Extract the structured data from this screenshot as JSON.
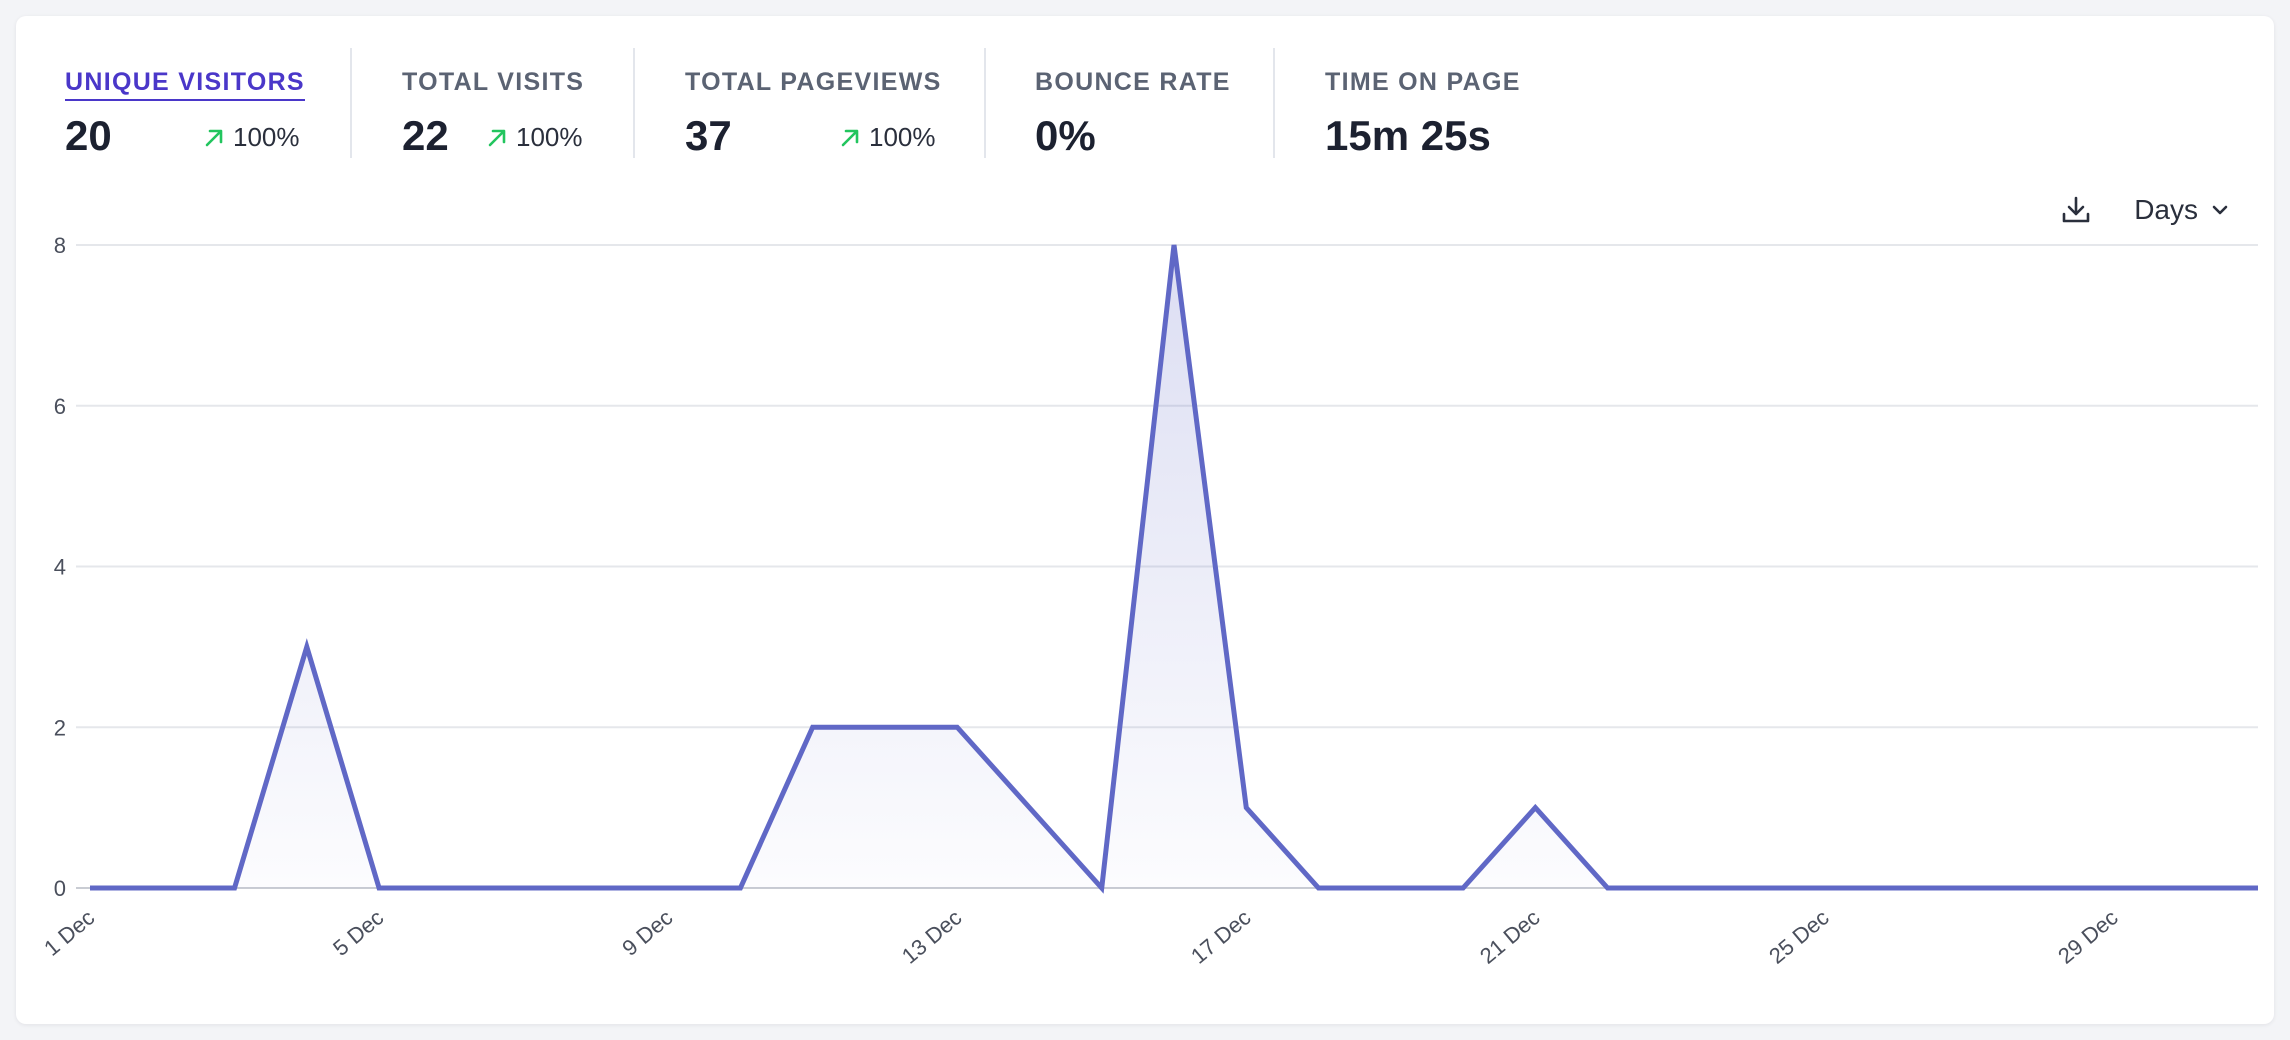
{
  "metrics": [
    {
      "label": "UNIQUE VISITORS",
      "value": "20",
      "change": "100%",
      "active": true
    },
    {
      "label": "TOTAL VISITS",
      "value": "22",
      "change": "100%"
    },
    {
      "label": "TOTAL PAGEVIEWS",
      "value": "37",
      "change": "100%"
    },
    {
      "label": "BOUNCE RATE",
      "value": "0%"
    },
    {
      "label": "TIME ON PAGE",
      "value": "15m 25s"
    }
  ],
  "toolbar": {
    "download_icon": "download-icon",
    "interval_label": "Days",
    "interval_icon": "chevron-down-icon"
  },
  "colors": {
    "accent": "#4a37c9",
    "line": "#6068c6",
    "increase": "#22c55e",
    "grid": "#e5e7eb"
  },
  "chart_data": {
    "type": "area",
    "title": "",
    "xlabel": "",
    "ylabel": "",
    "x": [
      "1 Dec",
      "2 Dec",
      "3 Dec",
      "4 Dec",
      "5 Dec",
      "6 Dec",
      "7 Dec",
      "8 Dec",
      "9 Dec",
      "10 Dec",
      "11 Dec",
      "12 Dec",
      "13 Dec",
      "14 Dec",
      "15 Dec",
      "16 Dec",
      "17 Dec",
      "18 Dec",
      "19 Dec",
      "20 Dec",
      "21 Dec",
      "22 Dec",
      "23 Dec",
      "24 Dec",
      "25 Dec",
      "26 Dec",
      "27 Dec",
      "28 Dec",
      "29 Dec",
      "30 Dec",
      "31 Dec"
    ],
    "values": [
      0,
      0,
      0,
      3,
      0,
      0,
      0,
      0,
      0,
      0,
      2,
      2,
      2,
      1,
      0,
      8,
      1,
      0,
      0,
      0,
      1,
      0,
      0,
      0,
      0,
      0,
      0,
      0,
      0,
      0,
      0
    ],
    "x_tick_labels": [
      "1 Dec",
      "5 Dec",
      "9 Dec",
      "13 Dec",
      "17 Dec",
      "21 Dec",
      "25 Dec",
      "29 Dec"
    ],
    "y_ticks": [
      0,
      2,
      4,
      6,
      8
    ],
    "ylim": [
      0,
      8
    ],
    "grid": true,
    "legend": false
  }
}
